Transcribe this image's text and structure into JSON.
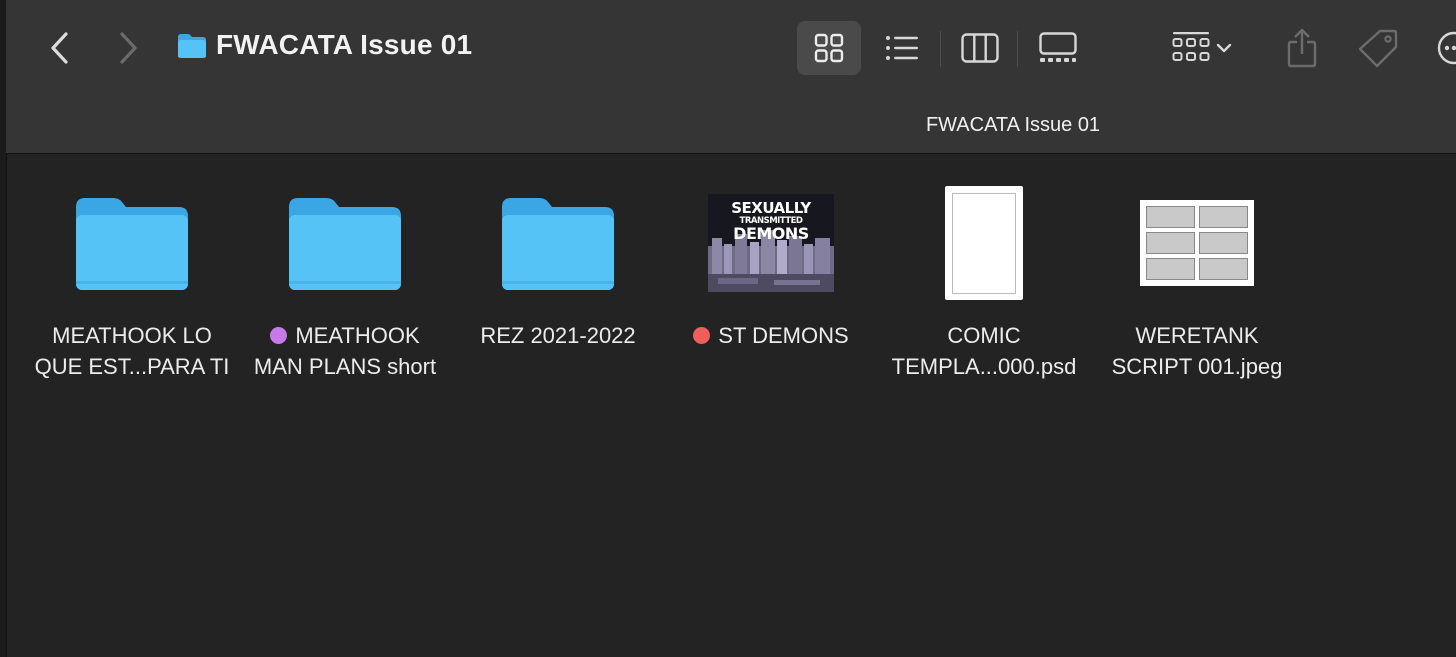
{
  "window": {
    "title": "FWACATA Issue 01",
    "path_title": "FWACATA Issue 01"
  },
  "toolbar": {
    "icons": {
      "back": "chevron-left-icon",
      "forward": "chevron-right-icon",
      "icon_view": "grid-icon",
      "list_view": "list-icon",
      "column_view": "columns-icon",
      "gallery_view": "gallery-icon",
      "group": "group-by-icon",
      "share": "share-icon",
      "tag": "tag-icon",
      "more": "more-icon"
    },
    "active_view": "icon"
  },
  "items": [
    {
      "kind": "folder",
      "label": "MEATHOOK LO\nQUE EST...PARA TI",
      "tag_color": null
    },
    {
      "kind": "folder",
      "label": "MEATHOOK\nMAN PLANS short",
      "tag_color": "#c77ae8"
    },
    {
      "kind": "folder",
      "label": "REZ 2021-2022",
      "tag_color": null
    },
    {
      "kind": "image",
      "label": "ST DEMONS",
      "tag_color": "#ee5f5b",
      "thumbnail_text": [
        "SEXUALLY",
        "TRANSMITTED",
        "DEMONS"
      ]
    },
    {
      "kind": "psd",
      "label": "COMIC\nTEMPLA...000.psd",
      "tag_color": null
    },
    {
      "kind": "jpeg",
      "label": "WERETANK\nSCRIPT 001.jpeg",
      "tag_color": null
    }
  ],
  "colors": {
    "toolbar_bg": "#353535",
    "content_bg": "#232323",
    "folder_blue": "#4fc0f5",
    "folder_tab": "#3aa6e3"
  }
}
